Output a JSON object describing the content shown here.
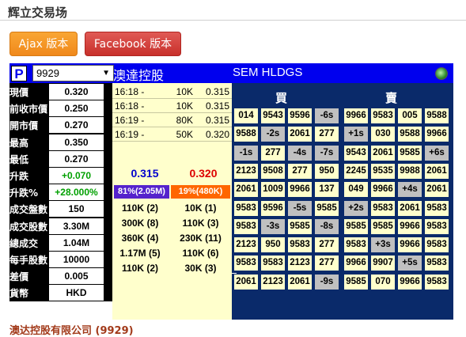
{
  "page_title": "辉立交易场",
  "buttons": {
    "ajax": "Ajax 版本",
    "facebook": "Facebook 版本"
  },
  "header": {
    "logo": "P",
    "stock_code": "9929",
    "name_cn": "澳達控股",
    "name_en": "SEM HLDGS",
    "status_color": "#2e8b2e"
  },
  "stats": [
    {
      "label": "現價",
      "value": "0.320"
    },
    {
      "label": "前收市價",
      "value": "0.250"
    },
    {
      "label": "開市價",
      "value": "0.270"
    },
    {
      "label": "最高",
      "value": "0.350"
    },
    {
      "label": "最低",
      "value": "0.270"
    },
    {
      "label": "升跌",
      "value": "+0.070",
      "color": "green"
    },
    {
      "label": "升跌%",
      "value": "+28.000%",
      "color": "green"
    },
    {
      "label": "成交盤數",
      "value": "150"
    },
    {
      "label": "成交股數",
      "value": "3.30M"
    },
    {
      "label": "總成交",
      "value": "1.04M"
    },
    {
      "label": "每手股數",
      "value": "10000"
    },
    {
      "label": "差價",
      "value": "0.005"
    },
    {
      "label": "貨幣",
      "value": "HKD"
    }
  ],
  "ticks": [
    {
      "time": "16:18 -",
      "vol": "10K",
      "price": "0.315"
    },
    {
      "time": "16:18 -",
      "vol": "10K",
      "price": "0.315"
    },
    {
      "time": "16:19 -",
      "vol": "80K",
      "price": "0.315"
    },
    {
      "time": "16:19 -",
      "vol": "50K",
      "price": "0.320"
    }
  ],
  "bid_price": "0.315",
  "ask_price": "0.320",
  "bid_pct": "81%(2.05M)",
  "ask_pct": "19%(480K)",
  "queue": [
    {
      "bid": "110K (2)",
      "ask": "10K (1)"
    },
    {
      "bid": "300K (8)",
      "ask": "110K (3)"
    },
    {
      "bid": "360K (4)",
      "ask": "230K (11)"
    },
    {
      "bid": "1.17M (5)",
      "ask": "110K (6)"
    },
    {
      "bid": "110K (2)",
      "ask": "30K (3)"
    }
  ],
  "broker_queue": {
    "bid_header": "買",
    "ask_header": "賣",
    "rows": [
      [
        "014",
        "9543",
        "9596",
        "-6s",
        "9966",
        "9583",
        "005",
        "9588"
      ],
      [
        "9588",
        "-2s",
        "2061",
        "277",
        "+1s",
        "030",
        "9588",
        "9966"
      ],
      [
        "-1s",
        "277",
        "-4s",
        "-7s",
        "9543",
        "2061",
        "9585",
        "+6s"
      ],
      [
        "2123",
        "9508",
        "277",
        "950",
        "2245",
        "9535",
        "9988",
        "2061"
      ],
      [
        "2061",
        "1009",
        "9966",
        "137",
        "049",
        "9966",
        "+4s",
        "2061"
      ],
      [
        "9583",
        "9596",
        "-5s",
        "9585",
        "+2s",
        "9583",
        "2061",
        "9583"
      ],
      [
        "9583",
        "-3s",
        "9585",
        "-8s",
        "9585",
        "9585",
        "9966",
        "9583"
      ],
      [
        "2123",
        "950",
        "9583",
        "277",
        "9583",
        "+3s",
        "9966",
        "9583"
      ],
      [
        "9583",
        "9583",
        "2123",
        "277",
        "9966",
        "9907",
        "+5s",
        "9583"
      ],
      [
        "2061",
        "2123",
        "2061",
        "-9s",
        "9585",
        "070",
        "9966",
        "9583"
      ]
    ]
  },
  "company_name": "澳达控股有限公司 (9929)"
}
